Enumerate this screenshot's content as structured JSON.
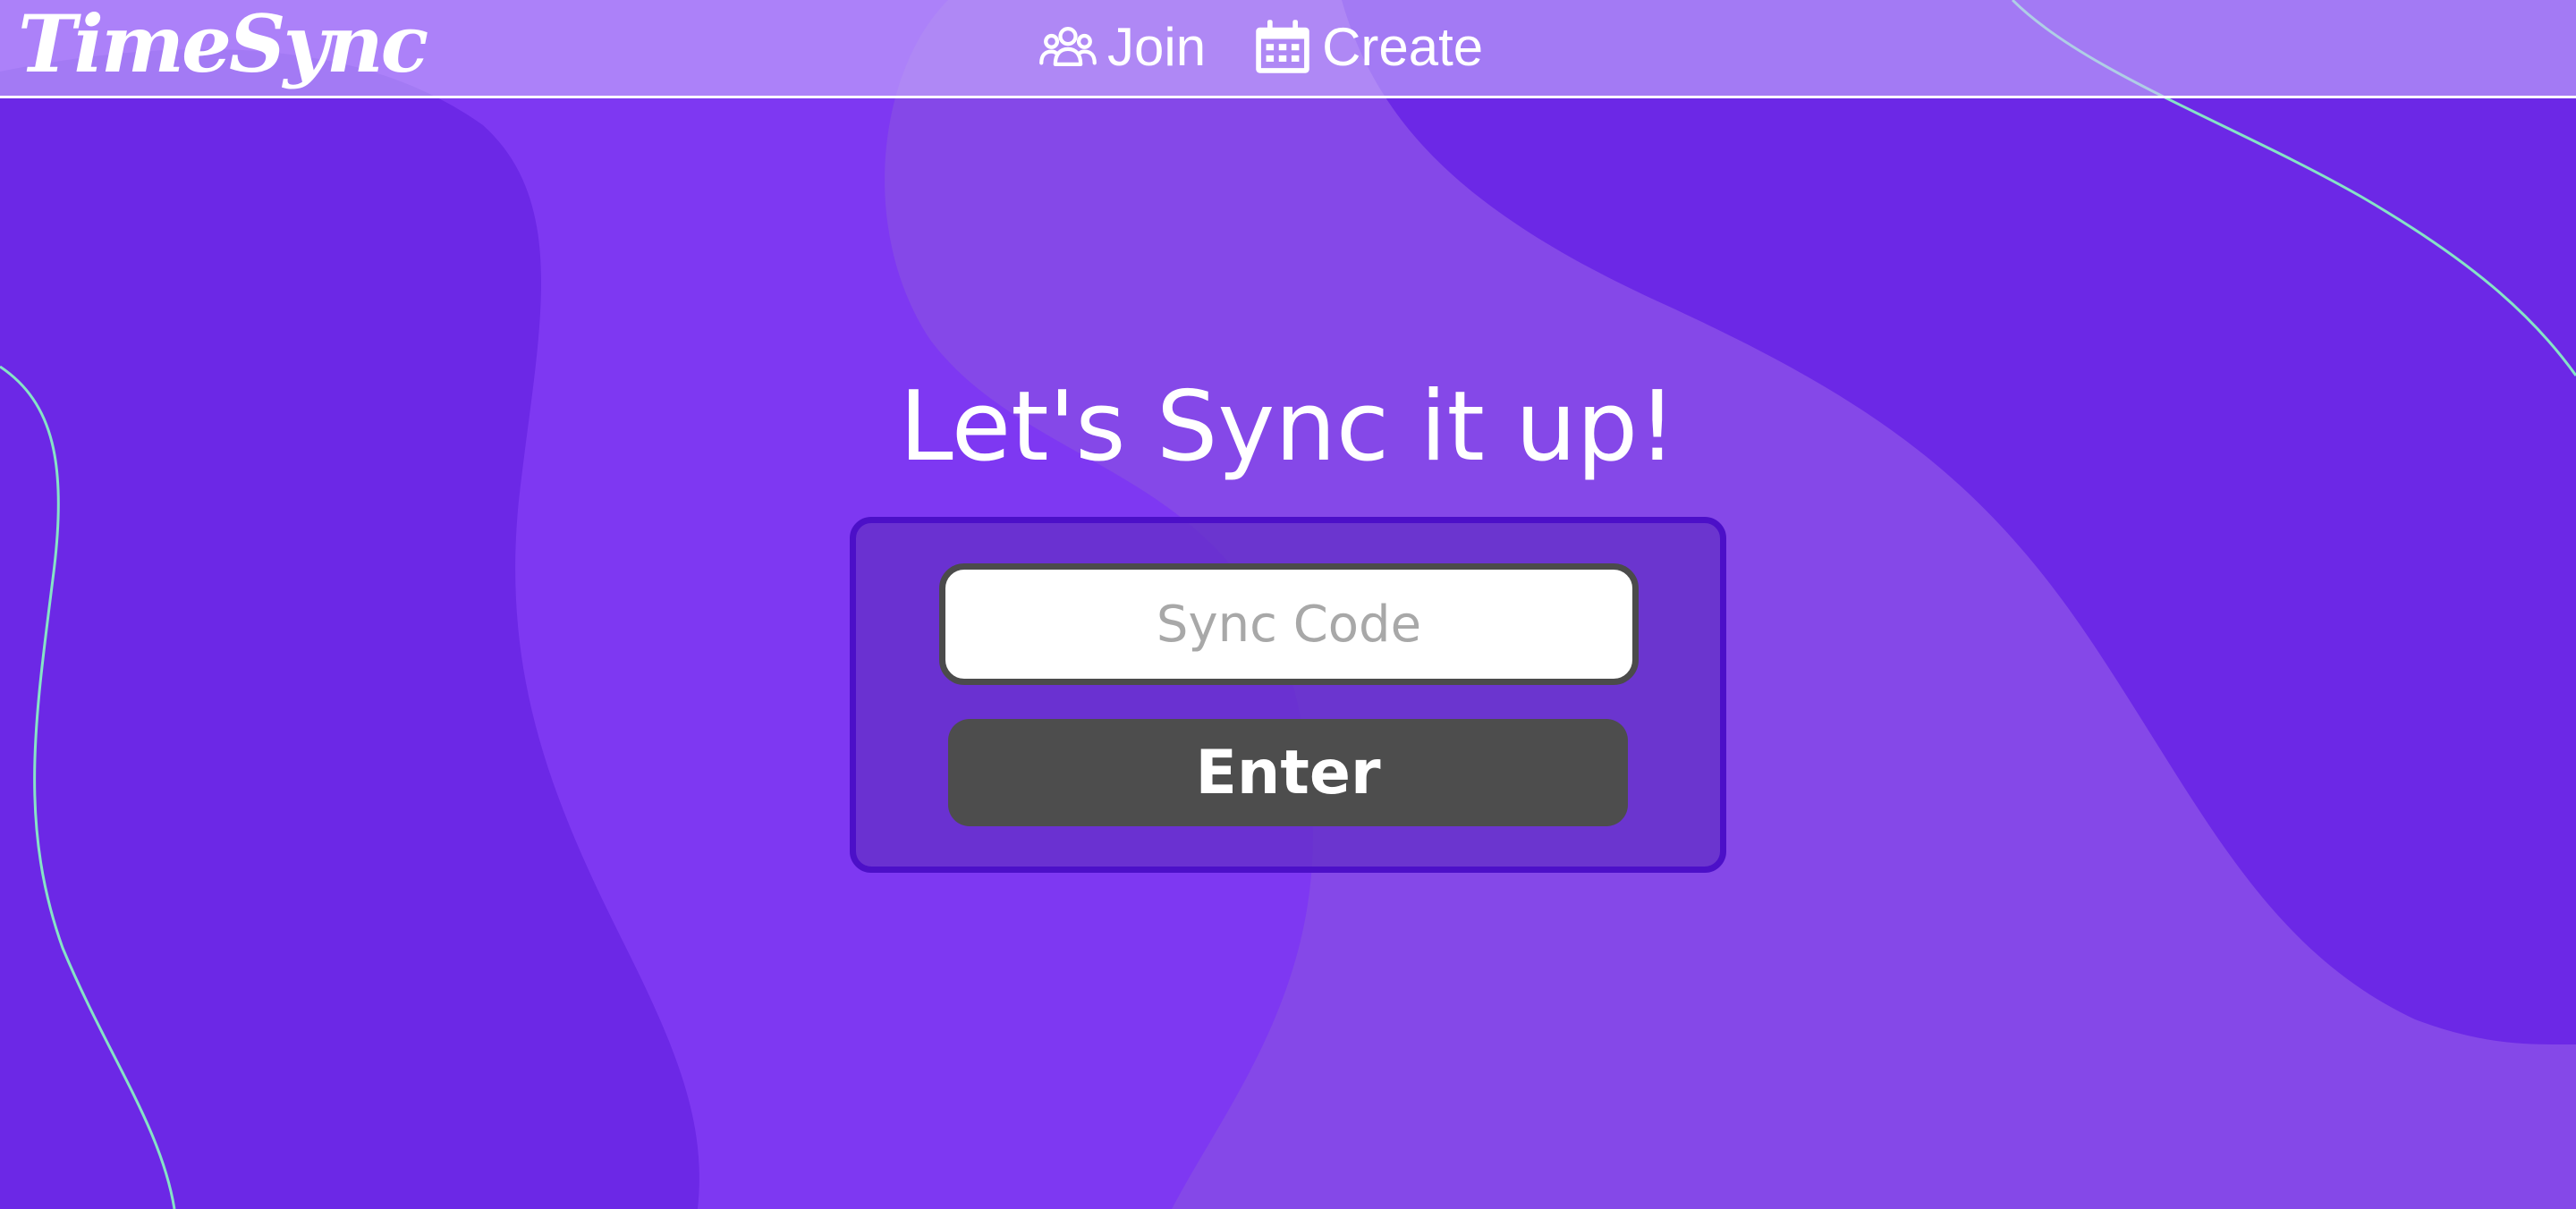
{
  "app": {
    "logo_text": "TimeSync"
  },
  "nav": {
    "items": [
      {
        "label": "Join",
        "icon": "people-group-icon"
      },
      {
        "label": "Create",
        "icon": "calendar-icon"
      }
    ]
  },
  "main": {
    "headline": "Let's Sync it up!",
    "code_input": {
      "value": "",
      "placeholder": "Sync Code"
    },
    "enter_button_label": "Enter"
  },
  "colors": {
    "background": "#7e38f2",
    "blob_dark": "#6c28e6",
    "blob_light": "#8548e8",
    "card": "#6430c8",
    "card_border": "#4c10c8",
    "button": "#4d4d4d",
    "accent_line": "#86e3c6"
  }
}
